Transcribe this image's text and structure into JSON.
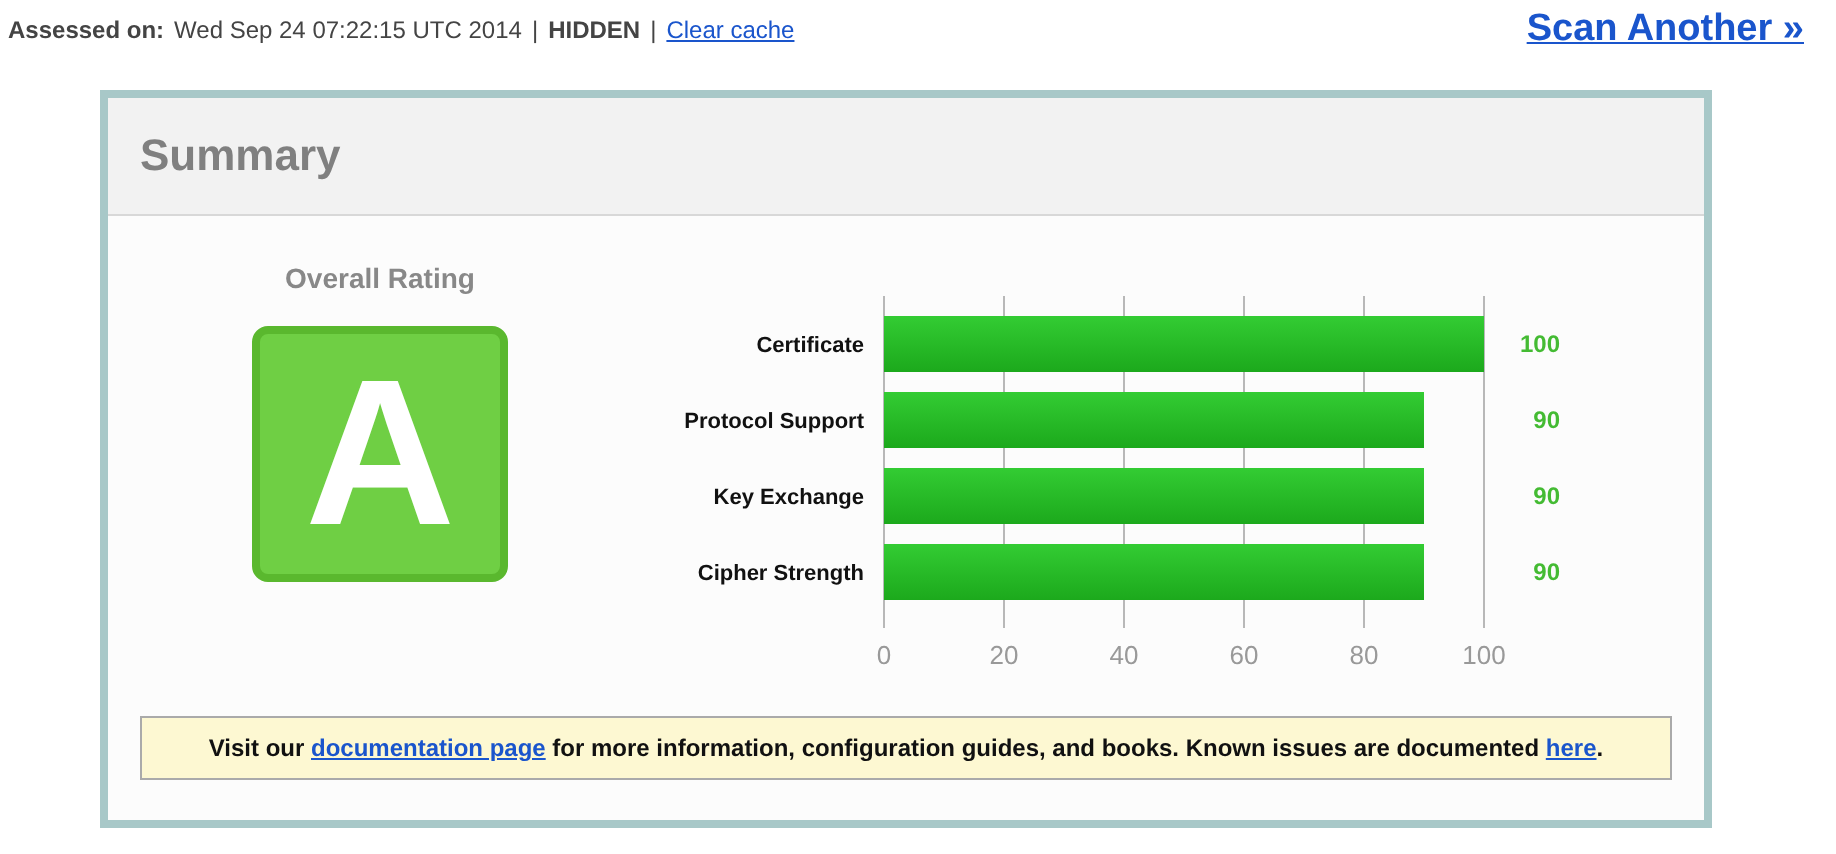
{
  "header": {
    "assessed_label": "Assessed on:",
    "assessed_value": "Wed Sep 24 07:22:15 UTC 2014",
    "separator_1": "|",
    "hidden": "HIDDEN",
    "separator_2": "|",
    "clear_cache": "Clear cache",
    "scan_another": "Scan Another »"
  },
  "summary": {
    "title": "Summary",
    "rating_label": "Overall Rating",
    "grade": "A",
    "chart_data": {
      "type": "bar",
      "orientation": "horizontal",
      "categories": [
        "Certificate",
        "Protocol Support",
        "Key Exchange",
        "Cipher Strength"
      ],
      "values": [
        100,
        90,
        90,
        90
      ],
      "xlim": [
        0,
        100
      ],
      "xticks": [
        0,
        20,
        40,
        60,
        80,
        100
      ],
      "grid": true,
      "data_labels": true
    },
    "notice": [
      {
        "kind": "text",
        "text": "Visit our "
      },
      {
        "kind": "link",
        "text": "documentation page"
      },
      {
        "kind": "text",
        "text": " for more information, configuration guides, and books. Known issues are documented "
      },
      {
        "kind": "link",
        "text": "here"
      },
      {
        "kind": "text",
        "text": "."
      }
    ]
  }
}
